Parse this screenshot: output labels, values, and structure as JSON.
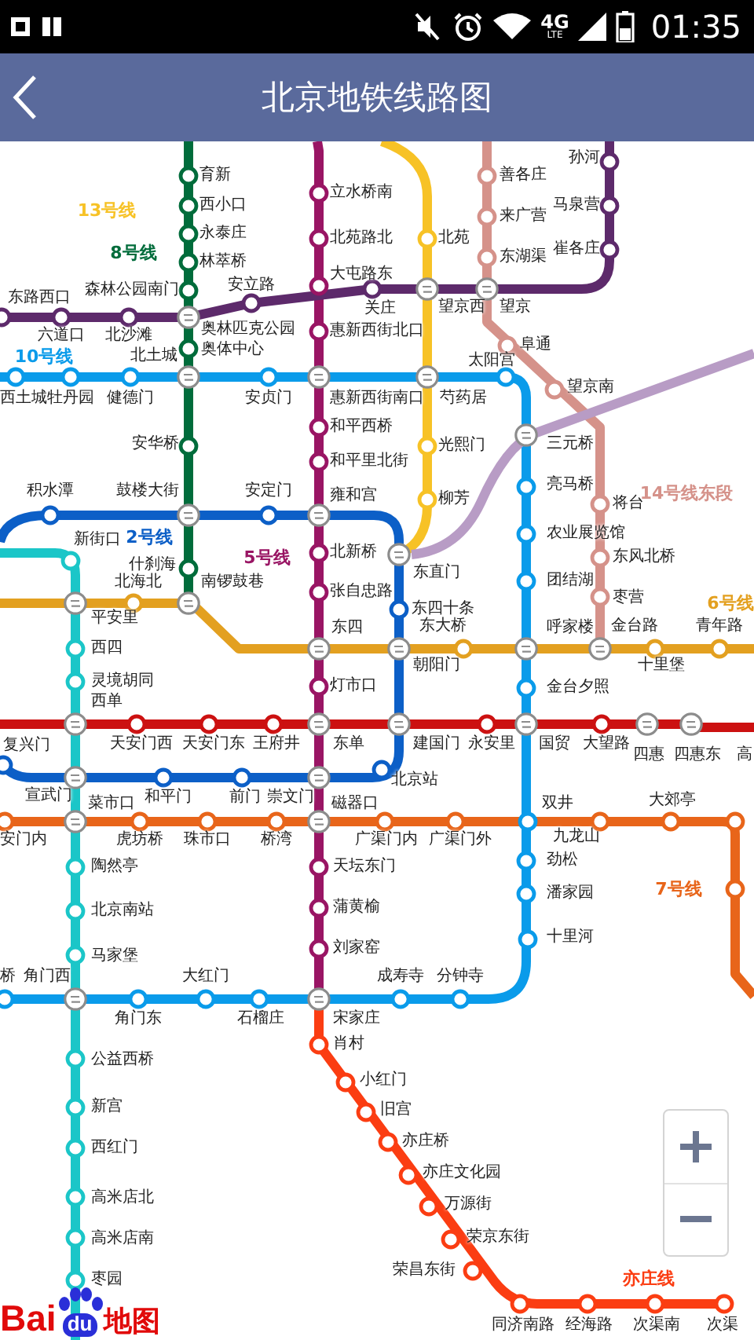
{
  "status_bar": {
    "network": "4G",
    "network_sub": "LTE",
    "time": "01:35"
  },
  "header": {
    "title": "北京地铁线路图"
  },
  "map": {
    "lines": [
      {
        "label": "13号线",
        "color": "#f7c226"
      },
      {
        "label": "8号线",
        "color": "#006c3b"
      },
      {
        "label": "10号线",
        "color": "#0a9bea"
      },
      {
        "label": "2号线",
        "color": "#0c5fc7"
      },
      {
        "label": "5号线",
        "color": "#991564"
      },
      {
        "label": "14号线东段",
        "color": "#d5928a"
      },
      {
        "label": "6号线",
        "color": "#e3a020"
      },
      {
        "label": "7号线",
        "color": "#e8651a"
      },
      {
        "label": "亦庄线",
        "color": "#fb3d12"
      },
      {
        "color": "#5d2a6b"
      },
      {
        "color": "#b89cc5"
      },
      {
        "color": "#cc1111"
      },
      {
        "color": "#1bc6c8"
      }
    ],
    "stations": [
      {
        "name": "孙河",
        "kind": "stop",
        "color": "#5d2a6b"
      },
      {
        "name": "善各庄",
        "kind": "stop",
        "color": "#d5928a"
      },
      {
        "name": "育新",
        "kind": "stop",
        "color": "#006c3b"
      },
      {
        "name": "立水桥南",
        "kind": "stop",
        "color": "#991564"
      },
      {
        "name": "马泉营",
        "kind": "stop",
        "color": "#5d2a6b"
      },
      {
        "name": "西小口",
        "kind": "stop",
        "color": "#006c3b"
      },
      {
        "name": "来广营",
        "kind": "stop",
        "color": "#d5928a"
      },
      {
        "name": "永泰庄",
        "kind": "stop",
        "color": "#006c3b"
      },
      {
        "name": "北苑路北",
        "kind": "stop",
        "color": "#991564"
      },
      {
        "name": "北苑",
        "kind": "stop",
        "color": "#f7c226"
      },
      {
        "name": "林萃桥",
        "kind": "stop",
        "color": "#006c3b"
      },
      {
        "name": "东湖渠",
        "kind": "stop",
        "color": "#d5928a"
      },
      {
        "name": "崔各庄",
        "kind": "stop",
        "color": "#5d2a6b"
      },
      {
        "name": "大屯路东",
        "kind": "stop",
        "color": "#991564"
      },
      {
        "name": "安立路",
        "kind": "stop",
        "color": "#5d2a6b"
      },
      {
        "name": "森林公园南门",
        "kind": "stop",
        "color": "#006c3b"
      },
      {
        "name": "关庄",
        "kind": "stop",
        "color": "#5d2a6b"
      },
      {
        "name": "望京西",
        "kind": "transfer"
      },
      {
        "name": "望京",
        "kind": "transfer"
      },
      {
        "name": "东路西口",
        "kind": "stop",
        "color": "#5d2a6b"
      },
      {
        "name": "六道口",
        "kind": "stop",
        "color": "#5d2a6b"
      },
      {
        "name": "北沙滩",
        "kind": "stop",
        "color": "#5d2a6b"
      },
      {
        "name": "奥林匹克公园",
        "kind": "transfer"
      },
      {
        "name": "惠新西街北口",
        "kind": "stop",
        "color": "#991564"
      },
      {
        "name": "奥体中心",
        "kind": "stop",
        "color": "#006c3b"
      },
      {
        "name": "阜通",
        "kind": "stop",
        "color": "#d5928a"
      },
      {
        "name": "北土城",
        "kind": "transfer"
      },
      {
        "name": "太阳宫",
        "kind": "stop",
        "color": "#0a9bea"
      },
      {
        "name": "西土城",
        "kind": "stop",
        "color": "#0a9bea"
      },
      {
        "name": "牡丹园",
        "kind": "stop",
        "color": "#0a9bea"
      },
      {
        "name": "健德门",
        "kind": "stop",
        "color": "#0a9bea"
      },
      {
        "name": "安贞门",
        "kind": "stop",
        "color": "#0a9bea"
      },
      {
        "name": "惠新西街南口",
        "kind": "transfer"
      },
      {
        "name": "芍药居",
        "kind": "transfer"
      },
      {
        "name": "望京南",
        "kind": "stop",
        "color": "#d5928a"
      },
      {
        "name": "三元桥",
        "kind": "transfer"
      },
      {
        "name": "和平西桥",
        "kind": "stop",
        "color": "#991564"
      },
      {
        "name": "安华桥",
        "kind": "stop",
        "color": "#006c3b"
      },
      {
        "name": "光熙门",
        "kind": "stop",
        "color": "#f7c226"
      },
      {
        "name": "和平里北街",
        "kind": "stop",
        "color": "#991564"
      },
      {
        "name": "亮马桥",
        "kind": "stop",
        "color": "#0a9bea"
      },
      {
        "name": "积水潭",
        "kind": "stop",
        "color": "#0c5fc7"
      },
      {
        "name": "鼓楼大街",
        "kind": "transfer"
      },
      {
        "name": "安定门",
        "kind": "stop",
        "color": "#0c5fc7"
      },
      {
        "name": "雍和宫",
        "kind": "transfer"
      },
      {
        "name": "柳芳",
        "kind": "stop",
        "color": "#f7c226"
      },
      {
        "name": "将台",
        "kind": "stop",
        "color": "#d5928a"
      },
      {
        "name": "农业展览馆",
        "kind": "stop",
        "color": "#0a9bea"
      },
      {
        "name": "新街口",
        "kind": "stop",
        "color": "#1bc6c8"
      },
      {
        "name": "北新桥",
        "kind": "stop",
        "color": "#991564"
      },
      {
        "name": "东直门",
        "kind": "transfer"
      },
      {
        "name": "东风北桥",
        "kind": "stop",
        "color": "#d5928a"
      },
      {
        "name": "什刹海",
        "kind": "stop",
        "color": "#006c3b"
      },
      {
        "name": "北海北",
        "kind": "stop",
        "color": "#e3a020"
      },
      {
        "name": "南锣鼓巷",
        "kind": "transfer"
      },
      {
        "name": "张自忠路",
        "kind": "stop",
        "color": "#991564"
      },
      {
        "name": "团结湖",
        "kind": "stop",
        "color": "#0a9bea"
      },
      {
        "name": "枣营",
        "kind": "stop",
        "color": "#d5928a"
      },
      {
        "name": "东四十条",
        "kind": "stop",
        "color": "#0c5fc7"
      },
      {
        "name": "平安里",
        "kind": "transfer"
      },
      {
        "name": "东大桥",
        "kind": "stop",
        "color": "#e3a020"
      },
      {
        "name": "呼家楼",
        "kind": "transfer"
      },
      {
        "name": "金台路",
        "kind": "transfer"
      },
      {
        "name": "青年路",
        "kind": "stop",
        "color": "#e3a020"
      },
      {
        "name": "西四",
        "kind": "stop",
        "color": "#1bc6c8"
      },
      {
        "name": "东四",
        "kind": "transfer"
      },
      {
        "name": "朝阳门",
        "kind": "transfer"
      },
      {
        "name": "十里堡",
        "kind": "stop",
        "color": "#e3a020"
      },
      {
        "name": "灵境胡同",
        "kind": "stop",
        "color": "#1bc6c8"
      },
      {
        "name": "灯市口",
        "kind": "stop",
        "color": "#991564"
      },
      {
        "name": "金台夕照",
        "kind": "stop",
        "color": "#0a9bea"
      },
      {
        "name": "西单",
        "kind": "transfer"
      },
      {
        "name": "复兴门",
        "kind": "stop",
        "color": "#0c5fc7"
      },
      {
        "name": "天安门西",
        "kind": "stop",
        "color": "#cc1111"
      },
      {
        "name": "天安门东",
        "kind": "stop",
        "color": "#cc1111"
      },
      {
        "name": "王府井",
        "kind": "stop",
        "color": "#cc1111"
      },
      {
        "name": "东单",
        "kind": "transfer"
      },
      {
        "name": "建国门",
        "kind": "transfer"
      },
      {
        "name": "永安里",
        "kind": "stop",
        "color": "#cc1111"
      },
      {
        "name": "国贸",
        "kind": "transfer"
      },
      {
        "name": "大望路",
        "kind": "stop",
        "color": "#cc1111"
      },
      {
        "name": "四惠",
        "kind": "transfer"
      },
      {
        "name": "四惠东",
        "kind": "transfer"
      },
      {
        "name": "高",
        "kind": "name_only"
      },
      {
        "name": "北京站",
        "kind": "stop",
        "color": "#0c5fc7"
      },
      {
        "name": "宣武门",
        "kind": "transfer"
      },
      {
        "name": "和平门",
        "kind": "stop",
        "color": "#0c5fc7"
      },
      {
        "name": "前门",
        "kind": "stop",
        "color": "#0c5fc7"
      },
      {
        "name": "崇文门",
        "kind": "transfer"
      },
      {
        "name": "菜市口",
        "kind": "transfer"
      },
      {
        "name": "磁器口",
        "kind": "transfer"
      },
      {
        "name": "双井",
        "kind": "stop",
        "color": "#0a9bea"
      },
      {
        "name": "大郊亭",
        "kind": "stop",
        "color": "#e8651a"
      },
      {
        "name": "安门内",
        "kind": "stop",
        "color": "#e8651a"
      },
      {
        "name": "虎坊桥",
        "kind": "stop",
        "color": "#e8651a"
      },
      {
        "name": "珠市口",
        "kind": "stop",
        "color": "#e8651a"
      },
      {
        "name": "桥湾",
        "kind": "stop",
        "color": "#e8651a"
      },
      {
        "name": "广渠门内",
        "kind": "stop",
        "color": "#e8651a"
      },
      {
        "name": "广渠门外",
        "kind": "stop",
        "color": "#e8651a"
      },
      {
        "name": "九龙山",
        "kind": "stop",
        "color": "#e8651a"
      },
      {
        "name": "劲松",
        "kind": "stop",
        "color": "#0a9bea"
      },
      {
        "name": "陶然亭",
        "kind": "stop",
        "color": "#1bc6c8"
      },
      {
        "name": "天坛东门",
        "kind": "stop",
        "color": "#991564"
      },
      {
        "name": "潘家园",
        "kind": "stop",
        "color": "#0a9bea"
      },
      {
        "name": "蒲黄榆",
        "kind": "stop",
        "color": "#991564"
      },
      {
        "name": "北京南站",
        "kind": "stop",
        "color": "#1bc6c8"
      },
      {
        "name": "十里河",
        "kind": "stop",
        "color": "#0a9bea"
      },
      {
        "name": "刘家窑",
        "kind": "stop",
        "color": "#991564"
      },
      {
        "name": "马家堡",
        "kind": "stop",
        "color": "#1bc6c8"
      },
      {
        "name": "桥",
        "kind": "stop",
        "color": "#0a9bea"
      },
      {
        "name": "角门西",
        "kind": "transfer"
      },
      {
        "name": "大红门",
        "kind": "stop",
        "color": "#0a9bea"
      },
      {
        "name": "成寿寺",
        "kind": "stop",
        "color": "#0a9bea"
      },
      {
        "name": "分钟寺",
        "kind": "stop",
        "color": "#0a9bea"
      },
      {
        "name": "角门东",
        "kind": "stop",
        "color": "#0a9bea"
      },
      {
        "name": "石榴庄",
        "kind": "stop",
        "color": "#0a9bea"
      },
      {
        "name": "宋家庄",
        "kind": "transfer"
      },
      {
        "name": "肖村",
        "kind": "stop",
        "color": "#fb3d12"
      },
      {
        "name": "公益西桥",
        "kind": "stop",
        "color": "#1bc6c8"
      },
      {
        "name": "小红门",
        "kind": "stop",
        "color": "#fb3d12"
      },
      {
        "name": "新宫",
        "kind": "stop",
        "color": "#1bc6c8"
      },
      {
        "name": "旧宫",
        "kind": "stop",
        "color": "#fb3d12"
      },
      {
        "name": "亦庄桥",
        "kind": "stop",
        "color": "#fb3d12"
      },
      {
        "name": "西红门",
        "kind": "stop",
        "color": "#1bc6c8"
      },
      {
        "name": "亦庄文化园",
        "kind": "stop",
        "color": "#fb3d12"
      },
      {
        "name": "高米店北",
        "kind": "stop",
        "color": "#1bc6c8"
      },
      {
        "name": "万源街",
        "kind": "stop",
        "color": "#fb3d12"
      },
      {
        "name": "高米店南",
        "kind": "stop",
        "color": "#1bc6c8"
      },
      {
        "name": "荣京东街",
        "kind": "stop",
        "color": "#fb3d12"
      },
      {
        "name": "荣昌东街",
        "kind": "stop",
        "color": "#fb3d12"
      },
      {
        "name": "枣园",
        "kind": "stop",
        "color": "#1bc6c8"
      },
      {
        "name": "同济南路",
        "kind": "stop",
        "color": "#fb3d12"
      },
      {
        "name": "经海路",
        "kind": "stop",
        "color": "#fb3d12"
      },
      {
        "name": "次渠南",
        "kind": "stop",
        "color": "#fb3d12"
      },
      {
        "name": "次渠",
        "kind": "stop",
        "color": "#fb3d12"
      }
    ],
    "unnamed_stops": [
      {
        "color": "#e8651a"
      },
      {
        "color": "#e8651a"
      }
    ]
  },
  "logo": {
    "parts": [
      "Bai",
      "du",
      "地图"
    ]
  }
}
